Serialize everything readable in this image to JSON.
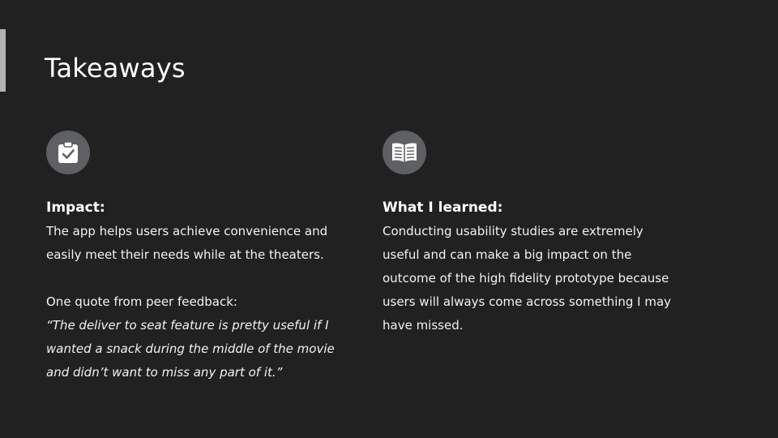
{
  "slide": {
    "title": "Takeaways"
  },
  "impact": {
    "icon": "clipboard-check-icon",
    "heading": "Impact:",
    "body_lines": [
      "The app helps users achieve convenience and",
      "easily meet their needs while at the theaters."
    ],
    "quote_intro": "One quote from peer feedback:",
    "quote_lines": [
      "“The deliver to seat feature is pretty useful if I",
      "wanted a snack during the middle of the movie",
      "and didn’t want to miss any part of it.”"
    ]
  },
  "learned": {
    "icon": "open-book-icon",
    "heading": "What I learned:",
    "body_lines": [
      "Conducting usability studies are extremely",
      "useful and can make a big impact on the",
      "outcome of the high fidelity prototype because",
      "users will always come across something I may",
      "have missed."
    ]
  },
  "colors": {
    "background": "#212121",
    "accent_bar": "#b3b3b3",
    "icon_circle": "#5f6063",
    "text": "#ffffff"
  }
}
